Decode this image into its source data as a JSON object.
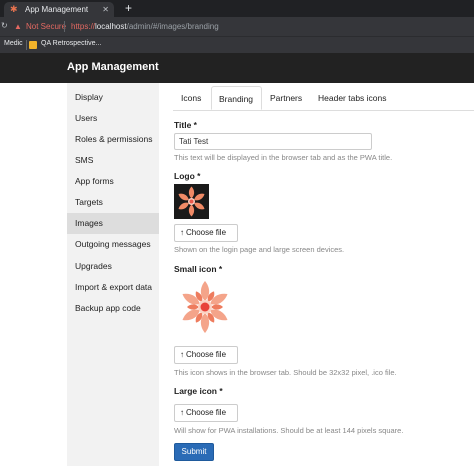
{
  "browser": {
    "tab_title": "App Management",
    "new_tab": "+",
    "security_label": "Not Secure",
    "url_protocol": "https://",
    "url_host": "localhost",
    "url_path": "/admin/#/images/branding",
    "bookmarks": [
      "Medic",
      "QA Retrospective..."
    ]
  },
  "app": {
    "title": "App Management"
  },
  "sidebar": {
    "items": [
      {
        "label": "Display"
      },
      {
        "label": "Users"
      },
      {
        "label": "Roles & permissions"
      },
      {
        "label": "SMS"
      },
      {
        "label": "App forms"
      },
      {
        "label": "Targets"
      },
      {
        "label": "Images",
        "active": true
      },
      {
        "label": "Outgoing messages"
      },
      {
        "label": "Upgrades"
      },
      {
        "label": "Import & export data"
      },
      {
        "label": "Backup app code"
      }
    ]
  },
  "tabs": [
    {
      "label": "Icons"
    },
    {
      "label": "Branding",
      "active": true
    },
    {
      "label": "Partners"
    },
    {
      "label": "Header tabs icons"
    }
  ],
  "form": {
    "title_label": "Title *",
    "title_value": "Tati Test",
    "title_help": "This text will be displayed in the browser tab and as the PWA title.",
    "logo_label": "Logo *",
    "logo_button": "Choose file",
    "logo_help": "Shown on the login page and large screen devices.",
    "small_icon_label": "Small icon *",
    "small_icon_button": "Choose file",
    "small_icon_help": "This icon shows in the browser tab. Should be 32x32 pixel, .ico file.",
    "large_icon_label": "Large icon *",
    "large_icon_button": "Choose file",
    "large_icon_help": "Will show for PWA installations. Should be at least 144 pixels square.",
    "submit": "Submit"
  },
  "colors": {
    "accent": "#2a6bb6",
    "brand": "#e8734f",
    "appbar": "#222222"
  },
  "icons": {
    "upload": "upload-arrow-icon",
    "logo": "flower-icon"
  }
}
